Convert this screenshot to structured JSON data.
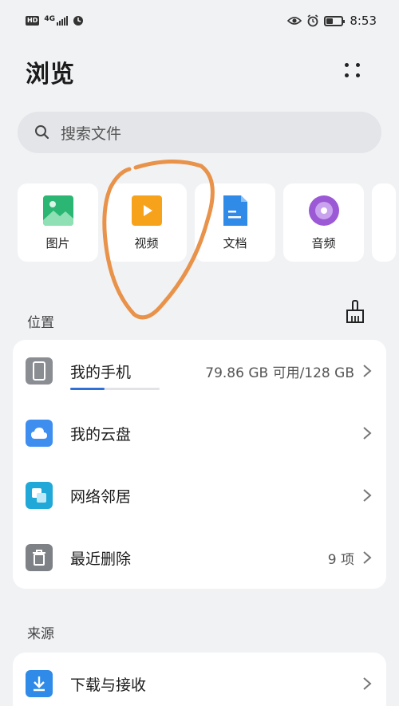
{
  "status_bar": {
    "hd": "HD",
    "network": "4G",
    "time": "8:53"
  },
  "header": {
    "title": "浏览"
  },
  "search": {
    "placeholder": "搜索文件"
  },
  "categories": [
    {
      "label": "图片",
      "icon": "image-icon",
      "color": "#2bb673"
    },
    {
      "label": "视频",
      "icon": "video-icon",
      "color": "#f7a21b"
    },
    {
      "label": "文档",
      "icon": "document-icon",
      "color": "#2f8ae8"
    },
    {
      "label": "音频",
      "icon": "audio-icon",
      "color": "#9b59d6"
    }
  ],
  "locations": {
    "section_label": "位置",
    "items": [
      {
        "label": "我的手机",
        "detail": "79.86 GB 可用/128 GB",
        "icon": "phone-icon",
        "color": "#8a8d92",
        "storage_used_fraction": 0.38
      },
      {
        "label": "我的云盘",
        "detail": "",
        "icon": "cloud-icon",
        "color": "#3e8ef0"
      },
      {
        "label": "网络邻居",
        "detail": "",
        "icon": "network-icon",
        "color": "#1fa8d8"
      },
      {
        "label": "最近删除",
        "detail": "9 项",
        "icon": "trash-icon",
        "color": "#7e8186"
      }
    ]
  },
  "sources": {
    "section_label": "来源",
    "items": [
      {
        "label": "下载与接收",
        "icon": "download-icon",
        "color": "#2f8ae8"
      }
    ]
  },
  "colors": {
    "background": "#f1f2f4",
    "card": "#ffffff",
    "accent": "#2f6fd8",
    "annotation": "#e8924a"
  }
}
